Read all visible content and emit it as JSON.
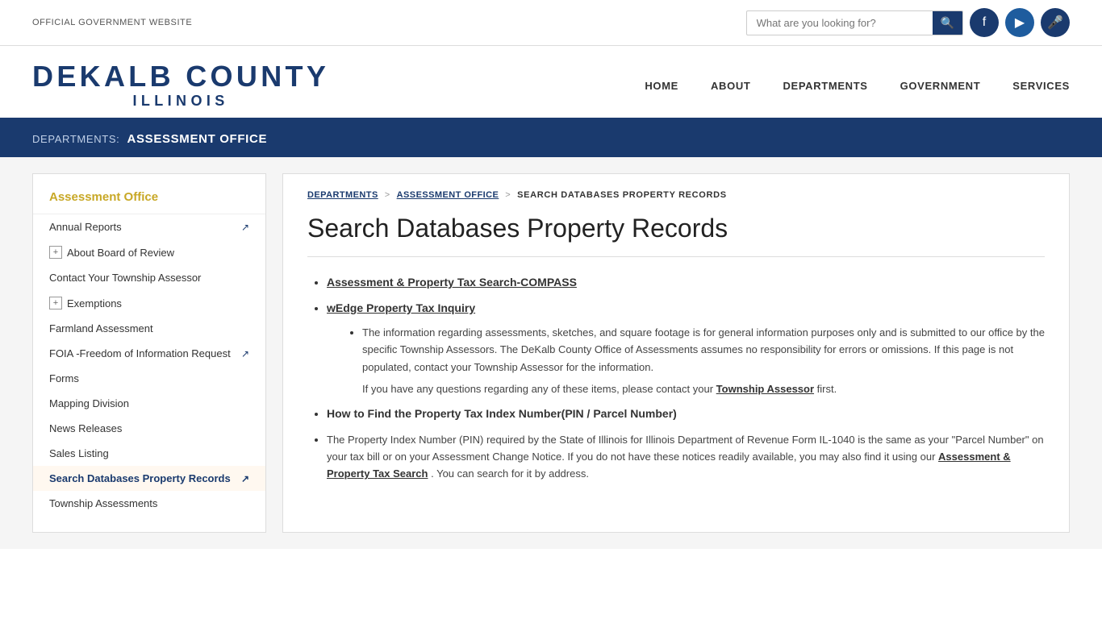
{
  "topbar": {
    "official_text": "OFFICIAL GOVERNMENT WEBSITE",
    "search_placeholder": "What are you looking for?"
  },
  "logo": {
    "line1": "DEKALB COUNTY",
    "line2": "ILLINOIS"
  },
  "nav": {
    "items": [
      {
        "label": "HOME",
        "id": "home"
      },
      {
        "label": "ABOUT",
        "id": "about"
      },
      {
        "label": "DEPARTMENTS",
        "id": "departments"
      },
      {
        "label": "GOVERNMENT",
        "id": "government"
      },
      {
        "label": "SERVICES",
        "id": "services"
      }
    ]
  },
  "dept_banner": {
    "label": "DEPARTMENTS:",
    "name": "ASSESSMENT OFFICE"
  },
  "sidebar": {
    "title": "Assessment Office",
    "items": [
      {
        "label": "Annual Reports",
        "has_plus": false,
        "has_ext": true,
        "active": false
      },
      {
        "label": "About Board of Review",
        "has_plus": true,
        "has_ext": false,
        "active": false
      },
      {
        "label": "Contact Your Township Assessor",
        "has_plus": false,
        "has_ext": false,
        "active": false
      },
      {
        "label": "Exemptions",
        "has_plus": true,
        "has_ext": false,
        "active": false
      },
      {
        "label": "Farmland Assessment",
        "has_plus": false,
        "has_ext": false,
        "active": false
      },
      {
        "label": "FOIA -Freedom of Information Request",
        "has_plus": false,
        "has_ext": true,
        "active": false
      },
      {
        "label": "Forms",
        "has_plus": false,
        "has_ext": false,
        "active": false
      },
      {
        "label": "Mapping Division",
        "has_plus": false,
        "has_ext": false,
        "active": false
      },
      {
        "label": "News Releases",
        "has_plus": false,
        "has_ext": false,
        "active": false
      },
      {
        "label": "Sales Listing",
        "has_plus": false,
        "has_ext": false,
        "active": false
      },
      {
        "label": "Search Databases Property Records",
        "has_plus": false,
        "has_ext": true,
        "active": true
      },
      {
        "label": "Township Assessments",
        "has_plus": false,
        "has_ext": false,
        "active": false
      }
    ]
  },
  "breadcrumb": {
    "items": [
      {
        "label": "DEPARTMENTS",
        "link": true
      },
      {
        "label": "ASSESSMENT OFFICE",
        "link": true
      },
      {
        "label": "SEARCH DATABASES PROPERTY RECORDS",
        "link": false
      }
    ]
  },
  "page": {
    "title": "Search Databases Property Records",
    "links": [
      {
        "label": "Assessment & Property Tax Search-COMPASS"
      },
      {
        "label": "wEdge Property Tax Inquiry"
      }
    ],
    "info_para1": "The information regarding assessments, sketches, and square footage is for general information purposes only and is submitted to our office by the specific Township Assessors. The DeKalb County Office of Assessments assumes no responsibility for errors or omissions. If this page is not populated, contact your Township Assessor for the information.",
    "info_para2": "If you have any questions regarding any of these items, please contact your",
    "info_para2_link": "Township Assessor",
    "info_para2_end": " first.",
    "pin_heading": "How to Find the Property Tax Index Number(PIN / Parcel Number)",
    "pin_para": "The Property Index Number (PIN) required by the State of Illinois for Illinois Department of Revenue Form IL-1040 is the same as your \"Parcel Number\" on your tax bill or on your Assessment Change Notice. If you do not have these notices readily available, you may also find it using our",
    "pin_link": "Assessment & Property Tax Search",
    "pin_end": ". You can search for it by address."
  }
}
